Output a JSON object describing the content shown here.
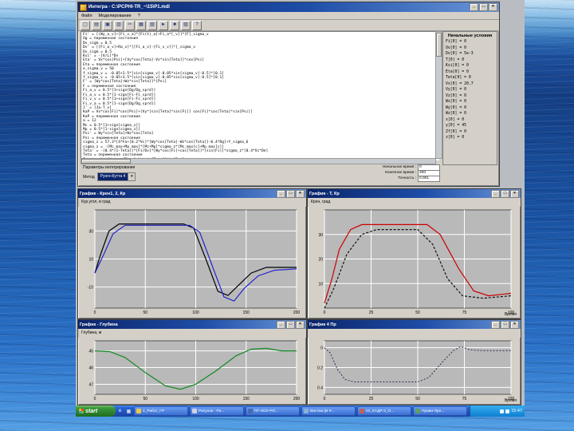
{
  "window": {
    "title": "Интегра - C:\\PCPHI-TR_~\\15\\P1.mdl",
    "menu": [
      "Файл",
      "Моделирование",
      "?"
    ],
    "toolbar_icons": [
      {
        "name": "new-file-icon",
        "glyph": "▢"
      },
      {
        "name": "open-folder-icon",
        "glyph": "▤"
      },
      {
        "name": "save-icon",
        "glyph": "▣"
      },
      {
        "name": "print-icon",
        "glyph": "▥"
      },
      {
        "name": "cut-icon",
        "glyph": "✂"
      },
      {
        "name": "copy-icon",
        "glyph": "▦"
      },
      {
        "name": "paste-icon",
        "glyph": "▧"
      },
      {
        "name": "run-icon",
        "glyph": "►"
      },
      {
        "name": "stop-icon",
        "glyph": "■"
      },
      {
        "name": "chart-icon",
        "glyph": "▨"
      },
      {
        "name": "help-icon",
        "glyph": "?"
      }
    ],
    "editor_lines": [
      "Fi' = [(Wy_a_v]+[Fi_v_a]*[Fi(t)_a]+Fi_a*[_v]]*[F]_sigma_v",
      "Og = переменная состояния",
      "Dv_sigm = 0.5",
      "Dv' = [[Fi_a_v]+Ra_v]*[[Fi_a_v]-[Fi_v_v]]*[_sigma_v",
      "Dv_sigm = 0.5",
      "Ksi' = -[V/L]*Dv",
      "Eta' = Vx*cos[Psi]+[Vy*cos[Teta]-Vz*sin[Teta]]*cos[Psi]",
      "Eta = переменная состояния",
      "e_sigma_v = 50",
      "f_sigma_v = -0.05+3.5*[sin[sigma_v]-0.05*sin[sigma_v]-0.5]*[0.1]",
      "f_sigma_v = -0.05+3.5*[sin[sigma_v]-0.05*sin[sigma_v]-0.5]*[0.1]",
      "F' = [Wy*cos[Teta]+Wz*sin[Teta]]*[Psi]",
      "F = переменная состояния",
      "Fi_a_v = 0.5*[1+sign[Dg/Dg_sprd]]",
      "Fi_a_v = 0.5*[1-sign[Fi-Fi_sprd]]",
      "Fi_v_v = 0.5*[1+sign[Fi-Fi_sprd]]",
      "Fi_v_a = 0.5*[1-sign[Dg/Dg_sprd]]",
      "J' = [Ja-T_v]",
      "KaP = Vx*cos[Fi]*cos[Psi]+[Vy*[sin[Teta]*sin[Fi]] cos[Fi]*cos[Teta]*sin[Psi]]",
      "KaP = переменная состояния",
      "a = 12",
      "Mc = 0.5*[1+sign[sigma_z]]",
      "Mp = 0.5*[1-sign[sigma_z]]",
      "Psi' = Wy*sin[Teta]+Wz*cos[Teta]",
      "Psi = переменная состояния",
      "sigma_z = 57.3*[4*Fa+[0.2*Vc]*[Wy*cos[Teta]-Wz*cos[Teta]]-0.4*Dg]+Y_sigma_6",
      "sigma_z = -[Mc_max+Mp_max]*[Mc+Mp]*sigma_z*[Mc_max[c]+Mp_max[c]]",
      "Teta' = -[0.4*[1-Teta]]*[Fi/Dv]*[Wy*cos[Fi]+cos[Teta]]*[sin[Fi]]*sigma_z*[0.4*Vc*De]",
      "Teta = переменная состояния",
      "Tema' = Wy*[Wz*cos[Teta]-Wz*sin[Teta]]*tg[Psi]"
    ],
    "initial_conditions": {
      "title": "Начальные условия",
      "items": [
        "Fi[0] = 0",
        "Ov[0] = 0",
        "Dv[0] = 5e-3",
        "T[0] = 0",
        "Ksi[0] = 0",
        "Eta[0] = 0",
        "Teta[0] = 0",
        "Vx[0] = 20.7",
        "Vy[0] = 0",
        "Vz[0] = 0",
        "Wx[0] = 0",
        "Wy[0] = 0",
        "Wz[0] = 0",
        "x[0] = 0",
        "y[0] = 45",
        "Zf[0] = 0",
        "z[0] = 0"
      ]
    },
    "params": {
      "section_title": "Параметры интегрирования",
      "method_label": "Метод",
      "method_value": "Рунге-Кутта 4",
      "fields": [
        {
          "label": "Начальное время :",
          "value": "0"
        },
        {
          "label": "Конечное время :",
          "value": "200"
        },
        {
          "label": "Точность :",
          "value": "0.001"
        }
      ]
    }
  },
  "chart_data": [
    {
      "type": "line",
      "title": "График - Крен1, 2, Кр",
      "ylabel": "Кур.угол, в град",
      "xlabel": "",
      "xlim": [
        0,
        200
      ],
      "ylim": [
        45,
        -25
      ],
      "xticks": [
        0,
        50,
        100,
        150,
        200
      ],
      "yticks": [
        30,
        10,
        -10
      ],
      "series": [
        {
          "name": "Крен1",
          "color": "#000000",
          "dash": "",
          "points": [
            [
              0,
              0
            ],
            [
              6,
              14
            ],
            [
              14,
              30
            ],
            [
              24,
              35
            ],
            [
              88,
              35
            ],
            [
              98,
              32
            ],
            [
              110,
              10
            ],
            [
              122,
              -13
            ],
            [
              132,
              -16
            ],
            [
              142,
              -9
            ],
            [
              155,
              0
            ],
            [
              170,
              4
            ],
            [
              200,
              4
            ]
          ]
        },
        {
          "name": "Кр",
          "color": "#2222cc",
          "dash": "",
          "points": [
            [
              0,
              0
            ],
            [
              8,
              12
            ],
            [
              18,
              28
            ],
            [
              30,
              34
            ],
            [
              94,
              34
            ],
            [
              104,
              29
            ],
            [
              118,
              2
            ],
            [
              128,
              -17
            ],
            [
              138,
              -20
            ],
            [
              148,
              -11
            ],
            [
              162,
              -2
            ],
            [
              178,
              2
            ],
            [
              200,
              3
            ]
          ]
        }
      ]
    },
    {
      "type": "line",
      "title": "График - T, Кр",
      "ylabel": "Крен, град",
      "xlabel": "Время",
      "xlim": [
        0,
        100
      ],
      "ylim": [
        40,
        0
      ],
      "xticks": [
        0,
        25,
        50,
        75,
        100
      ],
      "yticks": [
        30,
        20,
        10
      ],
      "series": [
        {
          "name": "T",
          "color": "#cc0000",
          "dash": "",
          "points": [
            [
              0,
              2
            ],
            [
              4,
              12
            ],
            [
              8,
              24
            ],
            [
              14,
              32
            ],
            [
              20,
              34
            ],
            [
              55,
              34
            ],
            [
              62,
              30
            ],
            [
              72,
              16
            ],
            [
              80,
              7
            ],
            [
              88,
              5
            ],
            [
              100,
              6
            ]
          ]
        },
        {
          "name": "Кр",
          "color": "#111111",
          "dash": "3,2",
          "points": [
            [
              0,
              0
            ],
            [
              5,
              8
            ],
            [
              12,
              22
            ],
            [
              20,
              30
            ],
            [
              28,
              32
            ],
            [
              50,
              32
            ],
            [
              58,
              26
            ],
            [
              66,
              12
            ],
            [
              74,
              5
            ],
            [
              85,
              4
            ],
            [
              100,
              5
            ]
          ]
        }
      ]
    },
    {
      "type": "line",
      "title": "График - Глубина",
      "ylabel": "Глубина, м",
      "xlabel": "",
      "xlim": [
        0,
        200
      ],
      "ylim": [
        44.4,
        47.6
      ],
      "xticks": [
        0,
        50,
        100,
        150,
        200
      ],
      "yticks": [
        45,
        46,
        47
      ],
      "series": [
        {
          "name": "Глубина",
          "color": "#118822",
          "dash": "",
          "points": [
            [
              0,
              45
            ],
            [
              15,
              45.05
            ],
            [
              30,
              45.4
            ],
            [
              50,
              46.3
            ],
            [
              70,
              47.1
            ],
            [
              85,
              47.3
            ],
            [
              100,
              47.0
            ],
            [
              120,
              46.2
            ],
            [
              140,
              45.3
            ],
            [
              155,
              44.9
            ],
            [
              170,
              44.85
            ],
            [
              185,
              45.0
            ],
            [
              200,
              45.0
            ]
          ]
        }
      ]
    },
    {
      "type": "line",
      "title": "График 4 Пр",
      "ylabel": "",
      "xlabel": "Время",
      "xlim": [
        0,
        100
      ],
      "ylim": [
        -0.07,
        0.47
      ],
      "xticks": [
        0,
        25,
        50,
        75,
        100
      ],
      "yticks": [
        0,
        0.2,
        0.4
      ],
      "series": [
        {
          "name": "Пр",
          "color": "#444466",
          "dash": "2,2",
          "points": [
            [
              0,
              0
            ],
            [
              3,
              0.05
            ],
            [
              7,
              0.22
            ],
            [
              11,
              0.32
            ],
            [
              16,
              0.345
            ],
            [
              50,
              0.345
            ],
            [
              56,
              0.3
            ],
            [
              63,
              0.15
            ],
            [
              69,
              0.03
            ],
            [
              73,
              -0.01
            ],
            [
              78,
              0.02
            ],
            [
              85,
              0.03
            ],
            [
              100,
              0.03
            ]
          ]
        }
      ]
    }
  ],
  "taskbar": {
    "start_label": "start",
    "quick_launch": [
      {
        "name": "ie-icon",
        "glyph": "e"
      },
      {
        "name": "show-desktop-icon",
        "glyph": "▦"
      }
    ],
    "buttons": [
      {
        "label": "4_Работ_ГР",
        "color": "#e8c84a"
      },
      {
        "label": "Рисунок - Pa...",
        "color": "#d0d0e8"
      },
      {
        "label": "ПГ-НОУ-РО...",
        "color": "#4a6ab0"
      },
      {
        "label": "Вистма [В Р...",
        "color": "#8ab0d8"
      },
      {
        "label": "01_КАДР-3_О...",
        "color": "#c06060"
      },
      {
        "label": "Прави-Пре...",
        "color": "#60a060"
      }
    ],
    "tray_icons": [
      {
        "name": "volume-icon"
      },
      {
        "name": "network-icon"
      }
    ],
    "clock": "15:47"
  }
}
